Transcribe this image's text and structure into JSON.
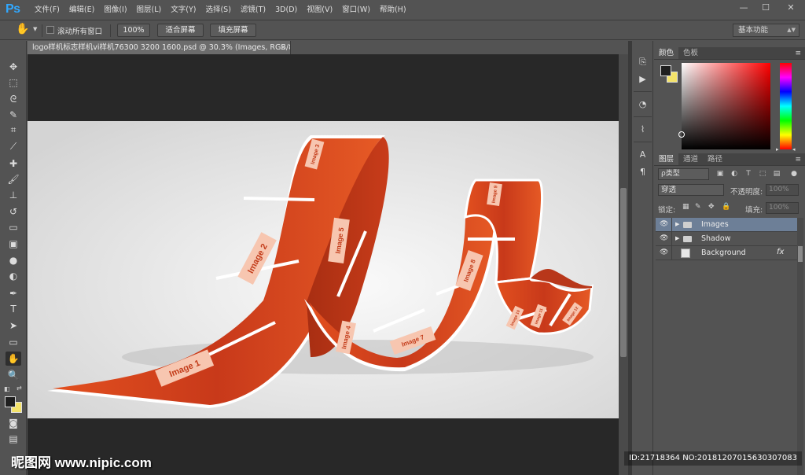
{
  "app": {
    "logo": "Ps",
    "menu": [
      "文件(F)",
      "编辑(E)",
      "图像(I)",
      "图层(L)",
      "文字(Y)",
      "选择(S)",
      "滤镜(T)",
      "3D(D)",
      "视图(V)",
      "窗口(W)",
      "帮助(H)"
    ],
    "window_controls": {
      "minimize": "—",
      "maximize": "☐",
      "close": "✕"
    }
  },
  "options_bar": {
    "scroll_all_label": "滚动所有窗口",
    "scroll_all_checked": false,
    "zoom100_label": "100%",
    "fit_screen_label": "适合屏幕",
    "fill_screen_label": "填充屏幕",
    "workspace": "基本功能"
  },
  "toolbar": {
    "tools": [
      "move-tool",
      "marquee-tool",
      "lasso-tool",
      "quick-select-tool",
      "crop-tool",
      "eyedropper-tool",
      "healing-brush-tool",
      "brush-tool",
      "clone-stamp-tool",
      "history-brush-tool",
      "eraser-tool",
      "gradient-tool",
      "blur-tool",
      "dodge-tool",
      "pen-tool",
      "type-tool",
      "path-select-tool",
      "rectangle-tool",
      "hand-tool",
      "zoom-tool"
    ],
    "active_tool": "hand-tool",
    "foreground_color": "#1f1f1f",
    "background_color": "#f4e36a"
  },
  "document": {
    "tab_title": "logo样机标志样机vi样机76300 3200 1600.psd @ 30.3% (Images, RGB/8)",
    "close": "×",
    "ribbon_color": "#d8471f",
    "background_color": "#e6e6e6",
    "frame_labels": [
      "Image 1",
      "Image 2",
      "Image 3",
      "Image 4",
      "Image 5",
      "Image 7",
      "Image 8",
      "Image 9",
      "Image 10",
      "Image 11",
      "Image 12"
    ]
  },
  "panels": {
    "color_tabs": [
      "颜色",
      "色板"
    ],
    "layer_tabs": [
      "图层",
      "通道",
      "路径"
    ],
    "kind_filter": "ρ类型",
    "blend_mode": "穿透",
    "opacity_label": "不透明度:",
    "opacity_value": "100%",
    "lock_label": "锁定:",
    "fill_label": "填充:",
    "fill_value": "100%",
    "layers": [
      {
        "name": "Images",
        "type": "group",
        "selected": true,
        "fx": ""
      },
      {
        "name": "Shadow",
        "type": "group",
        "selected": false,
        "fx": ""
      },
      {
        "name": "Background",
        "type": "layer",
        "selected": false,
        "fx": "fx"
      }
    ]
  },
  "watermark": {
    "logo": "昵图网 www.nipic.com",
    "id_text": "ID:21718364 NO:20181207015630307083"
  }
}
